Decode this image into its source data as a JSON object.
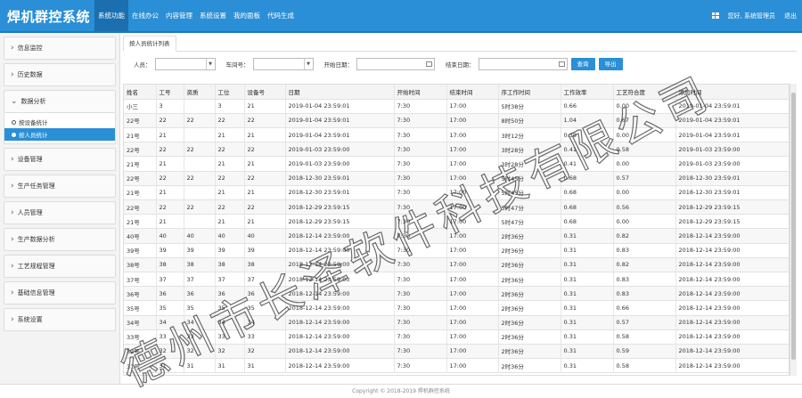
{
  "app": {
    "title": "焊机群控系统"
  },
  "nav": [
    {
      "label": "系统功能",
      "active": true
    },
    {
      "label": "在线办公"
    },
    {
      "label": "内容管理"
    },
    {
      "label": "系统设置"
    },
    {
      "label": "我的面板"
    },
    {
      "label": "代码生成"
    }
  ],
  "topright": {
    "user_greeting": "您好, 系统管理员",
    "logout": "退出",
    "icon": "grid-icon"
  },
  "sidebar": {
    "items": [
      {
        "label": "信息监控"
      },
      {
        "label": "历史数据"
      },
      {
        "label": "数据分析",
        "expanded": true,
        "children": [
          {
            "label": "按设备统计"
          },
          {
            "label": "按人员统计",
            "active": true
          }
        ]
      },
      {
        "label": "设备管理"
      },
      {
        "label": "生产任务管理"
      },
      {
        "label": "人员管理"
      },
      {
        "label": "生产数据分析"
      },
      {
        "label": "工艺规程管理"
      },
      {
        "label": "基础信息管理"
      },
      {
        "label": "系统设置"
      }
    ]
  },
  "tab": {
    "label": "按人员统计列表"
  },
  "filter": {
    "person_label": "人员：",
    "workshop_label": "车间号：",
    "start_label": "开始日期：",
    "end_label": "结束日期：",
    "query_button": "查询",
    "export_button": "导出"
  },
  "table": {
    "columns": [
      "姓名",
      "工号",
      "资质",
      "工位",
      "设备号",
      "日期",
      "开始时间",
      "结束时间",
      "序工作时间",
      "工作效率",
      "工艺符合度",
      "添加时间"
    ],
    "rows": [
      [
        "小三",
        "3",
        "",
        "3",
        "21",
        "2019-01-04 23:59:01",
        "7:30",
        "17:00",
        "5时38分",
        "0.66",
        "0.00",
        "2019-01-04 23:59:01"
      ],
      [
        "22号",
        "22",
        "22",
        "22",
        "22",
        "2019-01-04 23:59:01",
        "7:30",
        "17:00",
        "8时50分",
        "1.04",
        "0.67",
        "2019-01-04 23:59:01"
      ],
      [
        "21号",
        "21",
        "",
        "21",
        "21",
        "2019-01-04 23:59:01",
        "7:30",
        "17:00",
        "3时12分",
        "0.38",
        "0.00",
        "2019-01-04 23:59:01"
      ],
      [
        "22号",
        "22",
        "22",
        "22",
        "22",
        "2019-01-03 23:59:00",
        "7:30",
        "17:00",
        "3时28分",
        "0.41",
        "0.58",
        "2019-01-03 23:59:00"
      ],
      [
        "21号",
        "21",
        "",
        "21",
        "21",
        "2019-01-03 23:59:00",
        "7:30",
        "17:00",
        "3时28分",
        "0.41",
        "0.00",
        "2019-01-03 23:59:00"
      ],
      [
        "22号",
        "22",
        "22",
        "22",
        "22",
        "2018-12-30 23:59:01",
        "7:30",
        "17:00",
        "5时45分",
        "0.68",
        "0.57",
        "2018-12-30 23:59:01"
      ],
      [
        "21号",
        "21",
        "",
        "21",
        "21",
        "2018-12-30 23:59:01",
        "7:30",
        "17:00",
        "5时45分",
        "0.68",
        "0.00",
        "2018-12-30 23:59:01"
      ],
      [
        "22号",
        "22",
        "22",
        "22",
        "22",
        "2018-12-29 23:59:15",
        "7:30",
        "17:00",
        "5时47分",
        "0.68",
        "0.56",
        "2018-12-29 23:59:15"
      ],
      [
        "21号",
        "21",
        "",
        "21",
        "21",
        "2018-12-29 23:59:15",
        "7:30",
        "17:00",
        "5时47分",
        "0.68",
        "0.00",
        "2018-12-29 23:59:15"
      ],
      [
        "40号",
        "40",
        "40",
        "40",
        "40",
        "2018-12-14 23:59:00",
        "7:30",
        "17:00",
        "2时36分",
        "0.31",
        "0.82",
        "2018-12-14 23:59:00"
      ],
      [
        "39号",
        "39",
        "39",
        "39",
        "39",
        "2018-12-14 23:59:00",
        "7:30",
        "17:00",
        "2时36分",
        "0.31",
        "0.83",
        "2018-12-14 23:59:00"
      ],
      [
        "38号",
        "38",
        "38",
        "38",
        "38",
        "2018-12-14 23:59:00",
        "7:30",
        "17:00",
        "2时36分",
        "0.31",
        "0.82",
        "2018-12-14 23:59:00"
      ],
      [
        "37号",
        "37",
        "37",
        "37",
        "37",
        "2018-12-14 23:59:00",
        "7:30",
        "17:00",
        "2时36分",
        "0.31",
        "0.83",
        "2018-12-14 23:59:00"
      ],
      [
        "36号",
        "36",
        "36",
        "36",
        "36",
        "2018-12-14 23:59:00",
        "7:30",
        "17:00",
        "2时36分",
        "0.31",
        "0.83",
        "2018-12-14 23:59:00"
      ],
      [
        "35号",
        "35",
        "35",
        "35",
        "35",
        "2018-12-14 23:59:00",
        "7:30",
        "17:00",
        "2时36分",
        "0.31",
        "0.66",
        "2018-12-14 23:59:00"
      ],
      [
        "34号",
        "34",
        "34",
        "34",
        "34",
        "2018-12-14 23:59:00",
        "7:30",
        "17:00",
        "2时36分",
        "0.31",
        "0.57",
        "2018-12-14 23:59:00"
      ],
      [
        "33号",
        "33",
        "33",
        "33",
        "33",
        "2018-12-14 23:59:00",
        "7:30",
        "17:00",
        "2时36分",
        "0.31",
        "0.58",
        "2018-12-14 23:59:00"
      ],
      [
        "32号",
        "32",
        "32",
        "32",
        "32",
        "2018-12-14 23:59:00",
        "7:30",
        "17:00",
        "2时36分",
        "0.31",
        "0.59",
        "2018-12-14 23:59:00"
      ],
      [
        "31号",
        "31",
        "31",
        "31",
        "31",
        "2018-12-14 23:59:00",
        "7:30",
        "17:00",
        "2时36分",
        "0.31",
        "0.58",
        "2018-12-14 23:59:00"
      ]
    ]
  },
  "footer": {
    "copyright": "Copyright © 2018-2019 焊机群控系统"
  },
  "watermark": {
    "text": "德州市长泽软件科技有限公司",
    "color": "#3b3b3b"
  },
  "colors": {
    "header": "#2a8fd6",
    "active": "#1b6fae",
    "button": "#2a8fd6"
  }
}
